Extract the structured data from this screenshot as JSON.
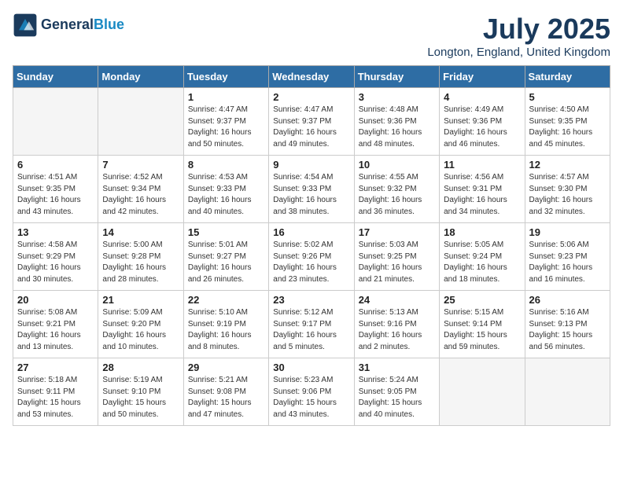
{
  "header": {
    "logo_line1": "General",
    "logo_line2": "Blue",
    "month_title": "July 2025",
    "location": "Longton, England, United Kingdom"
  },
  "days_of_week": [
    "Sunday",
    "Monday",
    "Tuesday",
    "Wednesday",
    "Thursday",
    "Friday",
    "Saturday"
  ],
  "weeks": [
    [
      {
        "day": "",
        "info": ""
      },
      {
        "day": "",
        "info": ""
      },
      {
        "day": "1",
        "info": "Sunrise: 4:47 AM\nSunset: 9:37 PM\nDaylight: 16 hours\nand 50 minutes."
      },
      {
        "day": "2",
        "info": "Sunrise: 4:47 AM\nSunset: 9:37 PM\nDaylight: 16 hours\nand 49 minutes."
      },
      {
        "day": "3",
        "info": "Sunrise: 4:48 AM\nSunset: 9:36 PM\nDaylight: 16 hours\nand 48 minutes."
      },
      {
        "day": "4",
        "info": "Sunrise: 4:49 AM\nSunset: 9:36 PM\nDaylight: 16 hours\nand 46 minutes."
      },
      {
        "day": "5",
        "info": "Sunrise: 4:50 AM\nSunset: 9:35 PM\nDaylight: 16 hours\nand 45 minutes."
      }
    ],
    [
      {
        "day": "6",
        "info": "Sunrise: 4:51 AM\nSunset: 9:35 PM\nDaylight: 16 hours\nand 43 minutes."
      },
      {
        "day": "7",
        "info": "Sunrise: 4:52 AM\nSunset: 9:34 PM\nDaylight: 16 hours\nand 42 minutes."
      },
      {
        "day": "8",
        "info": "Sunrise: 4:53 AM\nSunset: 9:33 PM\nDaylight: 16 hours\nand 40 minutes."
      },
      {
        "day": "9",
        "info": "Sunrise: 4:54 AM\nSunset: 9:33 PM\nDaylight: 16 hours\nand 38 minutes."
      },
      {
        "day": "10",
        "info": "Sunrise: 4:55 AM\nSunset: 9:32 PM\nDaylight: 16 hours\nand 36 minutes."
      },
      {
        "day": "11",
        "info": "Sunrise: 4:56 AM\nSunset: 9:31 PM\nDaylight: 16 hours\nand 34 minutes."
      },
      {
        "day": "12",
        "info": "Sunrise: 4:57 AM\nSunset: 9:30 PM\nDaylight: 16 hours\nand 32 minutes."
      }
    ],
    [
      {
        "day": "13",
        "info": "Sunrise: 4:58 AM\nSunset: 9:29 PM\nDaylight: 16 hours\nand 30 minutes."
      },
      {
        "day": "14",
        "info": "Sunrise: 5:00 AM\nSunset: 9:28 PM\nDaylight: 16 hours\nand 28 minutes."
      },
      {
        "day": "15",
        "info": "Sunrise: 5:01 AM\nSunset: 9:27 PM\nDaylight: 16 hours\nand 26 minutes."
      },
      {
        "day": "16",
        "info": "Sunrise: 5:02 AM\nSunset: 9:26 PM\nDaylight: 16 hours\nand 23 minutes."
      },
      {
        "day": "17",
        "info": "Sunrise: 5:03 AM\nSunset: 9:25 PM\nDaylight: 16 hours\nand 21 minutes."
      },
      {
        "day": "18",
        "info": "Sunrise: 5:05 AM\nSunset: 9:24 PM\nDaylight: 16 hours\nand 18 minutes."
      },
      {
        "day": "19",
        "info": "Sunrise: 5:06 AM\nSunset: 9:23 PM\nDaylight: 16 hours\nand 16 minutes."
      }
    ],
    [
      {
        "day": "20",
        "info": "Sunrise: 5:08 AM\nSunset: 9:21 PM\nDaylight: 16 hours\nand 13 minutes."
      },
      {
        "day": "21",
        "info": "Sunrise: 5:09 AM\nSunset: 9:20 PM\nDaylight: 16 hours\nand 10 minutes."
      },
      {
        "day": "22",
        "info": "Sunrise: 5:10 AM\nSunset: 9:19 PM\nDaylight: 16 hours\nand 8 minutes."
      },
      {
        "day": "23",
        "info": "Sunrise: 5:12 AM\nSunset: 9:17 PM\nDaylight: 16 hours\nand 5 minutes."
      },
      {
        "day": "24",
        "info": "Sunrise: 5:13 AM\nSunset: 9:16 PM\nDaylight: 16 hours\nand 2 minutes."
      },
      {
        "day": "25",
        "info": "Sunrise: 5:15 AM\nSunset: 9:14 PM\nDaylight: 15 hours\nand 59 minutes."
      },
      {
        "day": "26",
        "info": "Sunrise: 5:16 AM\nSunset: 9:13 PM\nDaylight: 15 hours\nand 56 minutes."
      }
    ],
    [
      {
        "day": "27",
        "info": "Sunrise: 5:18 AM\nSunset: 9:11 PM\nDaylight: 15 hours\nand 53 minutes."
      },
      {
        "day": "28",
        "info": "Sunrise: 5:19 AM\nSunset: 9:10 PM\nDaylight: 15 hours\nand 50 minutes."
      },
      {
        "day": "29",
        "info": "Sunrise: 5:21 AM\nSunset: 9:08 PM\nDaylight: 15 hours\nand 47 minutes."
      },
      {
        "day": "30",
        "info": "Sunrise: 5:23 AM\nSunset: 9:06 PM\nDaylight: 15 hours\nand 43 minutes."
      },
      {
        "day": "31",
        "info": "Sunrise: 5:24 AM\nSunset: 9:05 PM\nDaylight: 15 hours\nand 40 minutes."
      },
      {
        "day": "",
        "info": ""
      },
      {
        "day": "",
        "info": ""
      }
    ]
  ]
}
